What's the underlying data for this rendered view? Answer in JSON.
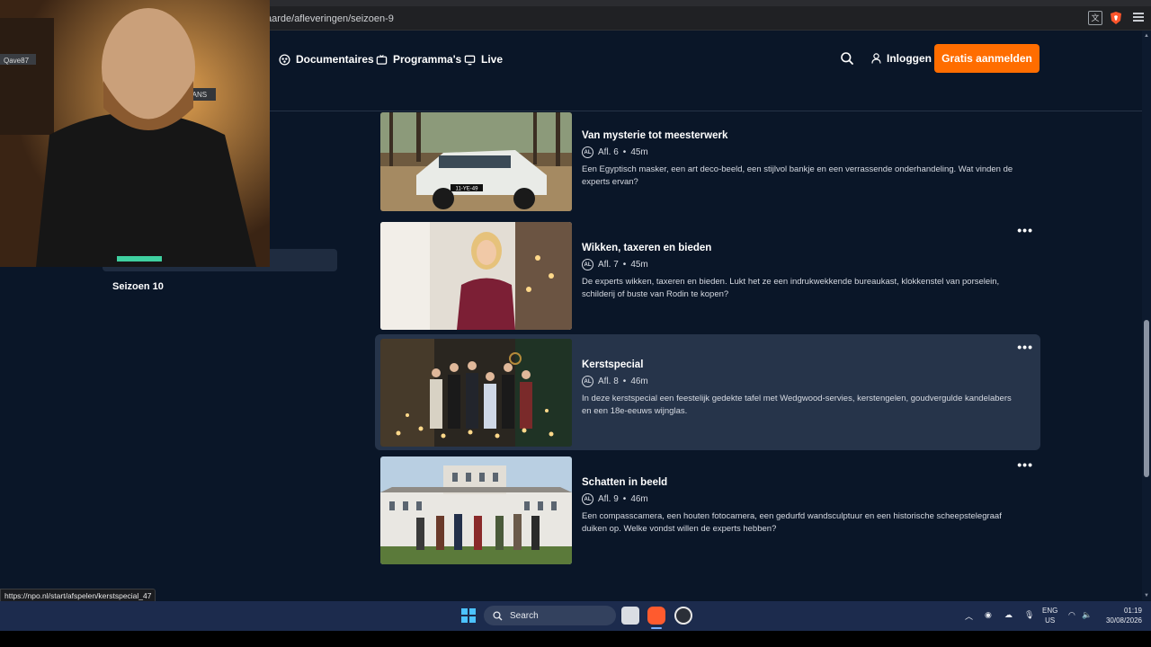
{
  "browser": {
    "url": "aarde/afleveringen/seizoen-9"
  },
  "nav": {
    "documentaires": "Documentaires",
    "programmas": "Programma's",
    "live": "Live",
    "login": "Inloggen",
    "signup": "Gratis aanmelden"
  },
  "sidebar": {
    "season_10": "Seizoen 10"
  },
  "episodes": [
    {
      "title": "Van mysterie tot meesterwerk",
      "rating": "AL",
      "afl": "Afl. 6",
      "duration": "45m",
      "description": "Een Egyptisch masker, een art deco-beeld, een stijlvol bankje en een verrassende onderhandeling. Wat vinden de experts ervan?",
      "plate": "11-YE-49"
    },
    {
      "title": "Wikken, taxeren en bieden",
      "rating": "AL",
      "afl": "Afl. 7",
      "duration": "45m",
      "description": "De experts wikken, taxeren en bieden. Lukt het ze een indrukwekkende bureaukast, klokkenstel van porselein, schilderij of buste van Rodin te kopen?"
    },
    {
      "title": "Kerstspecial",
      "rating": "AL",
      "afl": "Afl. 8",
      "duration": "46m",
      "description": "In deze kerstspecial een feestelijk gedekte tafel met Wedgwood-servies, kerstengelen, goudvergulde kandelabers en een 18e-eeuws wijnglas."
    },
    {
      "title": "Schatten in beeld",
      "rating": "AL",
      "afl": "Afl. 9",
      "duration": "46m",
      "description": "Een compasscamera, een houten fotocamera, een gedurfd wandsculptuur en een historische scheepstelegraaf duiken op. Welke vondst willen de experts hebben?"
    }
  ],
  "more_label": "•••",
  "meta_separator": "•",
  "status_url": "https://npo.nl/start/afspelen/kerstspecial_47",
  "taskbar": {
    "search": "Search",
    "lang_top": "ENG",
    "lang_bottom": "US",
    "time": "01:19",
    "date": "30/08/2026"
  },
  "webcam": {
    "poster_text": "MANS",
    "username": "Qave87"
  },
  "colors": {
    "background": "#0a1628",
    "accent": "#ff6d00",
    "highlight_row": "#26344a"
  }
}
